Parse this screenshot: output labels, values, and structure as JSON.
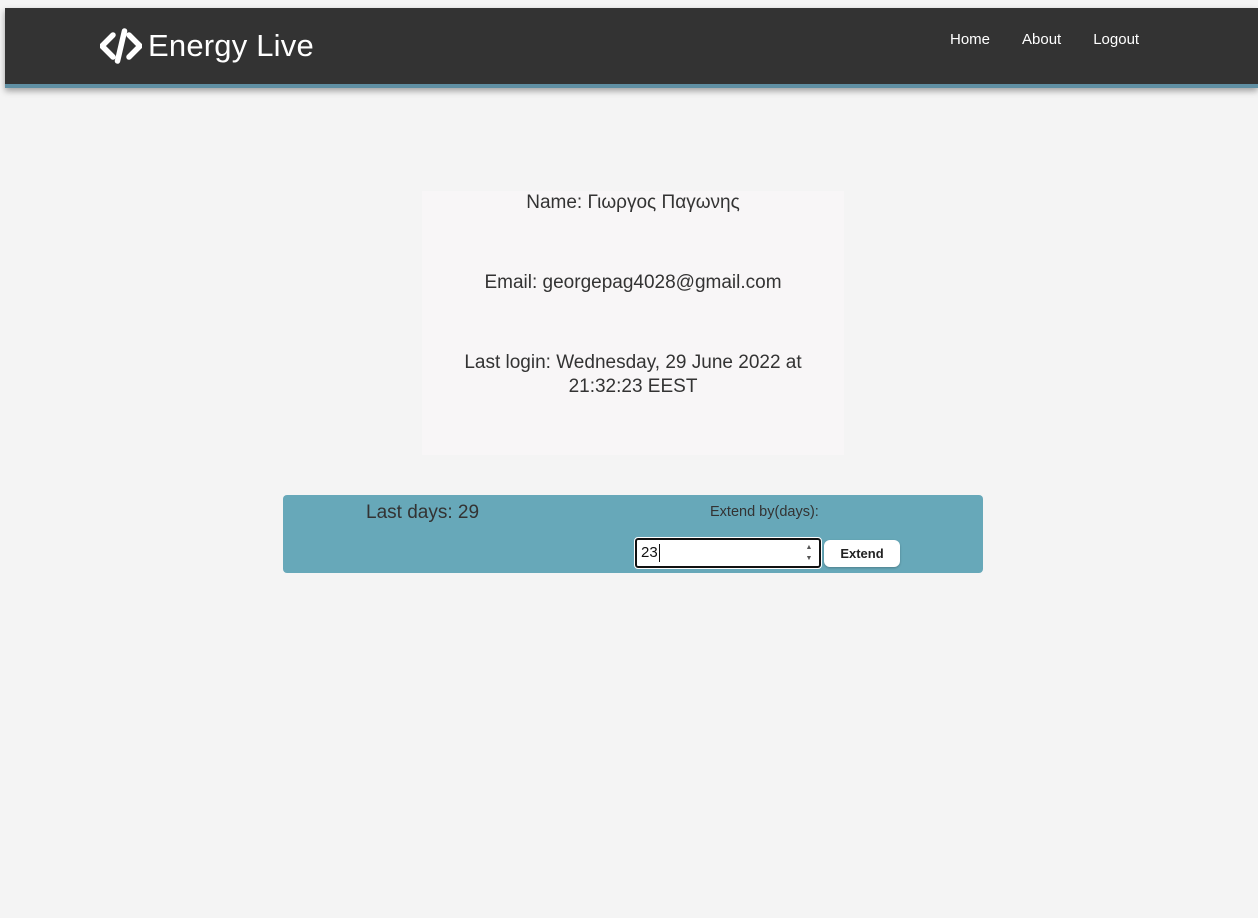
{
  "navbar": {
    "brand": "Energy Live",
    "brand_icon": "code-icon",
    "links": [
      "Home",
      "About",
      "Logout"
    ]
  },
  "profile": {
    "name": "Name: Γιωργος Παγωνης",
    "email": "Email: georgepag4028@gmail.com",
    "last_login": "Last login: Wednesday, 29 June 2022 at 21:32:23 EEST"
  },
  "subscription": {
    "days_left": "Last days: 29",
    "extend_label": "Extend by(days):",
    "extend_value": "23",
    "extend_button": "Extend"
  },
  "colors": {
    "navbar_bg": "#333333",
    "navbar_accent": "#5f8fa3",
    "panel_bg": "#67a8b9",
    "page_bg": "#f4f4f4"
  }
}
